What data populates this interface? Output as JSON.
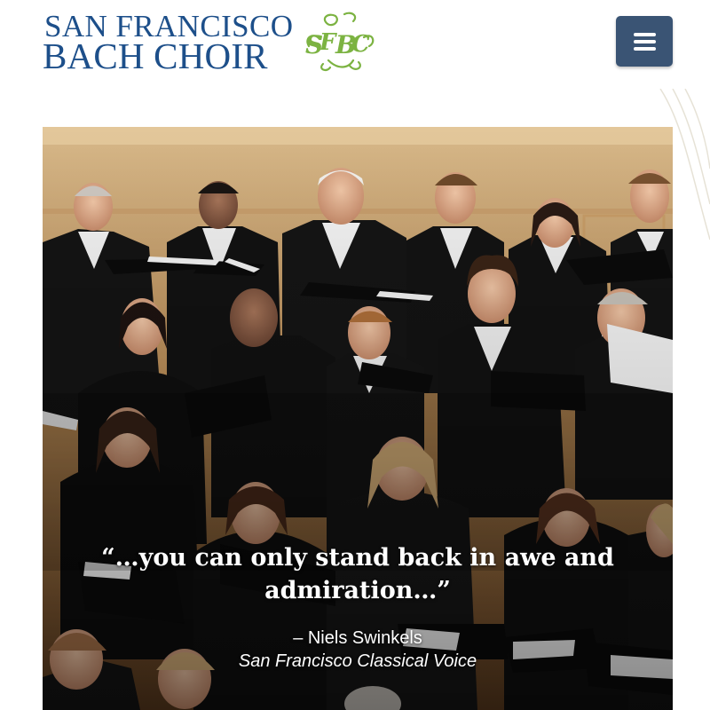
{
  "header": {
    "logo": {
      "line1": "SAN FRANCISCO",
      "line2": "BACH CHOIR",
      "monogram": "SFBC",
      "text_color": "#1d4f8a",
      "mark_color": "#7cb342"
    },
    "menu_button": {
      "icon": "hamburger-menu-icon",
      "color": "#3a5474"
    }
  },
  "hero": {
    "image_description_icon": "choir-photo",
    "quote": {
      "text": "“…you can only stand back in awe and admiration…”",
      "author": "– Niels Swinkels",
      "source": "San Francisco Classical Voice"
    }
  }
}
